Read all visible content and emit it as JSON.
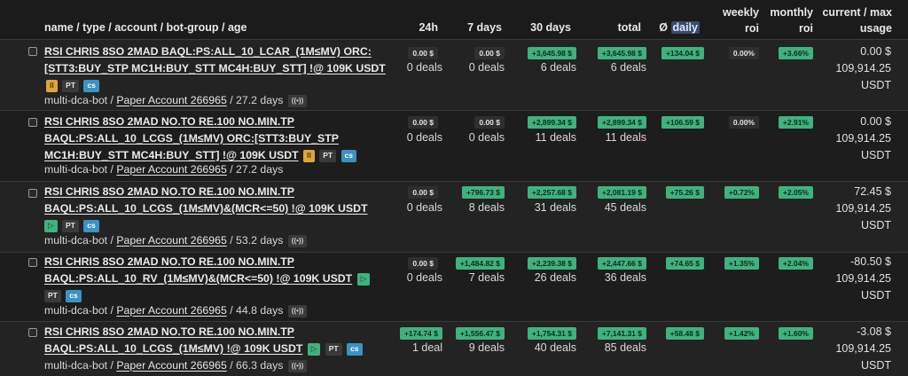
{
  "headers": {
    "name": "name / type / account / bot-group / age",
    "h24": "24h",
    "d7": "7 days",
    "d30": "30 days",
    "total": "total",
    "daily_prefix": "Ø",
    "daily": "daily",
    "weekly1": "weekly",
    "weekly2": "roi",
    "monthly1": "monthly",
    "monthly2": "roi",
    "usage1": "current / max",
    "usage2": "usage"
  },
  "rows": [
    {
      "line1": "RSI CHRIS 8SO 2MAD BAQL:PS:ALL_10_LCAR_(1M≤MV) ORC:",
      "line2": "[STT3:BUY_STP MC1H:BUY_STT MC4H:BUY_STT] !@ 109K USDT",
      "state_icon": "II",
      "pt": "PT",
      "cs": "cs",
      "group": "multi-dca-bot",
      "sep": "/",
      "account": "Paper Account 266965",
      "age": "/ 27.2 days",
      "ws": "((•))",
      "h24": "0.00 $",
      "h24_deals": "0 deals",
      "d7": "0.00 $",
      "d7_deals": "0 deals",
      "d30": "+3,645.98 $",
      "d30_deals": "6 deals",
      "total": "+3,645.98 $",
      "total_deals": "6 deals",
      "daily": "+134.04 $",
      "weekly": "0.00%",
      "monthly": "+3.66%",
      "cur1": "0.00 $",
      "cur2": "109,914.25",
      "cur3": "USDT"
    },
    {
      "line1": "RSI CHRIS 8SO 2MAD NO.TO RE.100 NO.MIN.TP",
      "line2": "BAQL:PS:ALL_10_LCGS_(1M≤MV) ORC:[STT3:BUY_STP",
      "line3": "MC1H:BUY_STT MC4H:BUY_STT] !@ 109K USDT",
      "state_icon": "II",
      "pt": "PT",
      "cs": "cs",
      "group": "multi-dca-bot",
      "sep": "/",
      "account": "Paper Account 266965",
      "age": "/ 27.2 days",
      "ws": "((•))",
      "h24": "0.00 $",
      "h24_deals": "0 deals",
      "d7": "0.00 $",
      "d7_deals": "0 deals",
      "d30": "+2,899.34 $",
      "d30_deals": "11 deals",
      "total": "+2,899.34 $",
      "total_deals": "11 deals",
      "daily": "+106.59 $",
      "weekly": "0.00%",
      "monthly": "+2.91%",
      "cur1": "0.00 $",
      "cur2": "109,914.25",
      "cur3": "USDT"
    },
    {
      "line1": "RSI CHRIS 8SO 2MAD NO.TO RE.100 NO.MIN.TP",
      "line2": "BAQL:PS:ALL_10_LCGS_(1M≤MV)&(MCR<=50) !@ 109K USDT",
      "state_icon": "▷",
      "pt": "PT",
      "cs": "cs",
      "group": "multi-dca-bot",
      "sep": "/",
      "account": "Paper Account 266965",
      "age": "/ 53.2 days",
      "ws": "((•))",
      "h24": "0.00 $",
      "h24_deals": "0 deals",
      "d7": "+796.73 $",
      "d7_deals": "8 deals",
      "d30": "+2,257.68 $",
      "d30_deals": "31 deals",
      "total": "+2,081.19 $",
      "total_deals": "45 deals",
      "daily": "+75.26 $",
      "weekly": "+0.72%",
      "monthly": "+2.05%",
      "cur1": "72.45 $",
      "cur2": "109,914.25",
      "cur3": "USDT"
    },
    {
      "line1": "RSI CHRIS 8SO 2MAD NO.TO RE.100 NO.MIN.TP",
      "line2": "BAQL:PS:ALL_10_RV_(1M≤MV)&(MCR<=50) !@ 109K USDT",
      "state_icon": "▷",
      "pt": "PT",
      "cs": "cs",
      "group": "multi-dca-bot",
      "sep": "/",
      "account": "Paper Account 266965",
      "age": "/ 44.8 days",
      "ws": "((•))",
      "h24": "0.00 $",
      "h24_deals": "0 deals",
      "d7": "+1,484.82 $",
      "d7_deals": "7 deals",
      "d30": "+2,239.38 $",
      "d30_deals": "26 deals",
      "total": "+2,447.66 $",
      "total_deals": "36 deals",
      "daily": "+74.65 $",
      "weekly": "+1.35%",
      "monthly": "+2.04%",
      "cur1": "-80.50 $",
      "cur2": "109,914.25",
      "cur3": "USDT"
    },
    {
      "line1": "RSI CHRIS 8SO 2MAD NO.TO RE.100 NO.MIN.TP",
      "line2": "BAQL:PS:ALL_10_LCGS_(1M≤MV) !@ 109K USDT",
      "state_icon": "▷",
      "pt": "PT",
      "cs": "cs",
      "group": "multi-dca-bot",
      "sep": "/",
      "account": "Paper Account 266965",
      "age": "/ 66.3 days",
      "ws": "((•))",
      "h24": "+174.74 $",
      "h24_deals": "1 deal",
      "d7": "+1,556.47 $",
      "d7_deals": "9 deals",
      "d30": "+1,754.31 $",
      "d30_deals": "40 deals",
      "total": "+7,141.31 $",
      "total_deals": "85 deals",
      "daily": "+58.48 $",
      "weekly": "+1.42%",
      "monthly": "+1.60%",
      "cur1": "-3.08 $",
      "cur2": "109,914.25",
      "cur3": "USDT"
    }
  ],
  "colors": {
    "positive": "#3fb27f",
    "neutral": "#2f2f2f",
    "paused": "#e0a53a",
    "cs": "#3a93c2"
  }
}
